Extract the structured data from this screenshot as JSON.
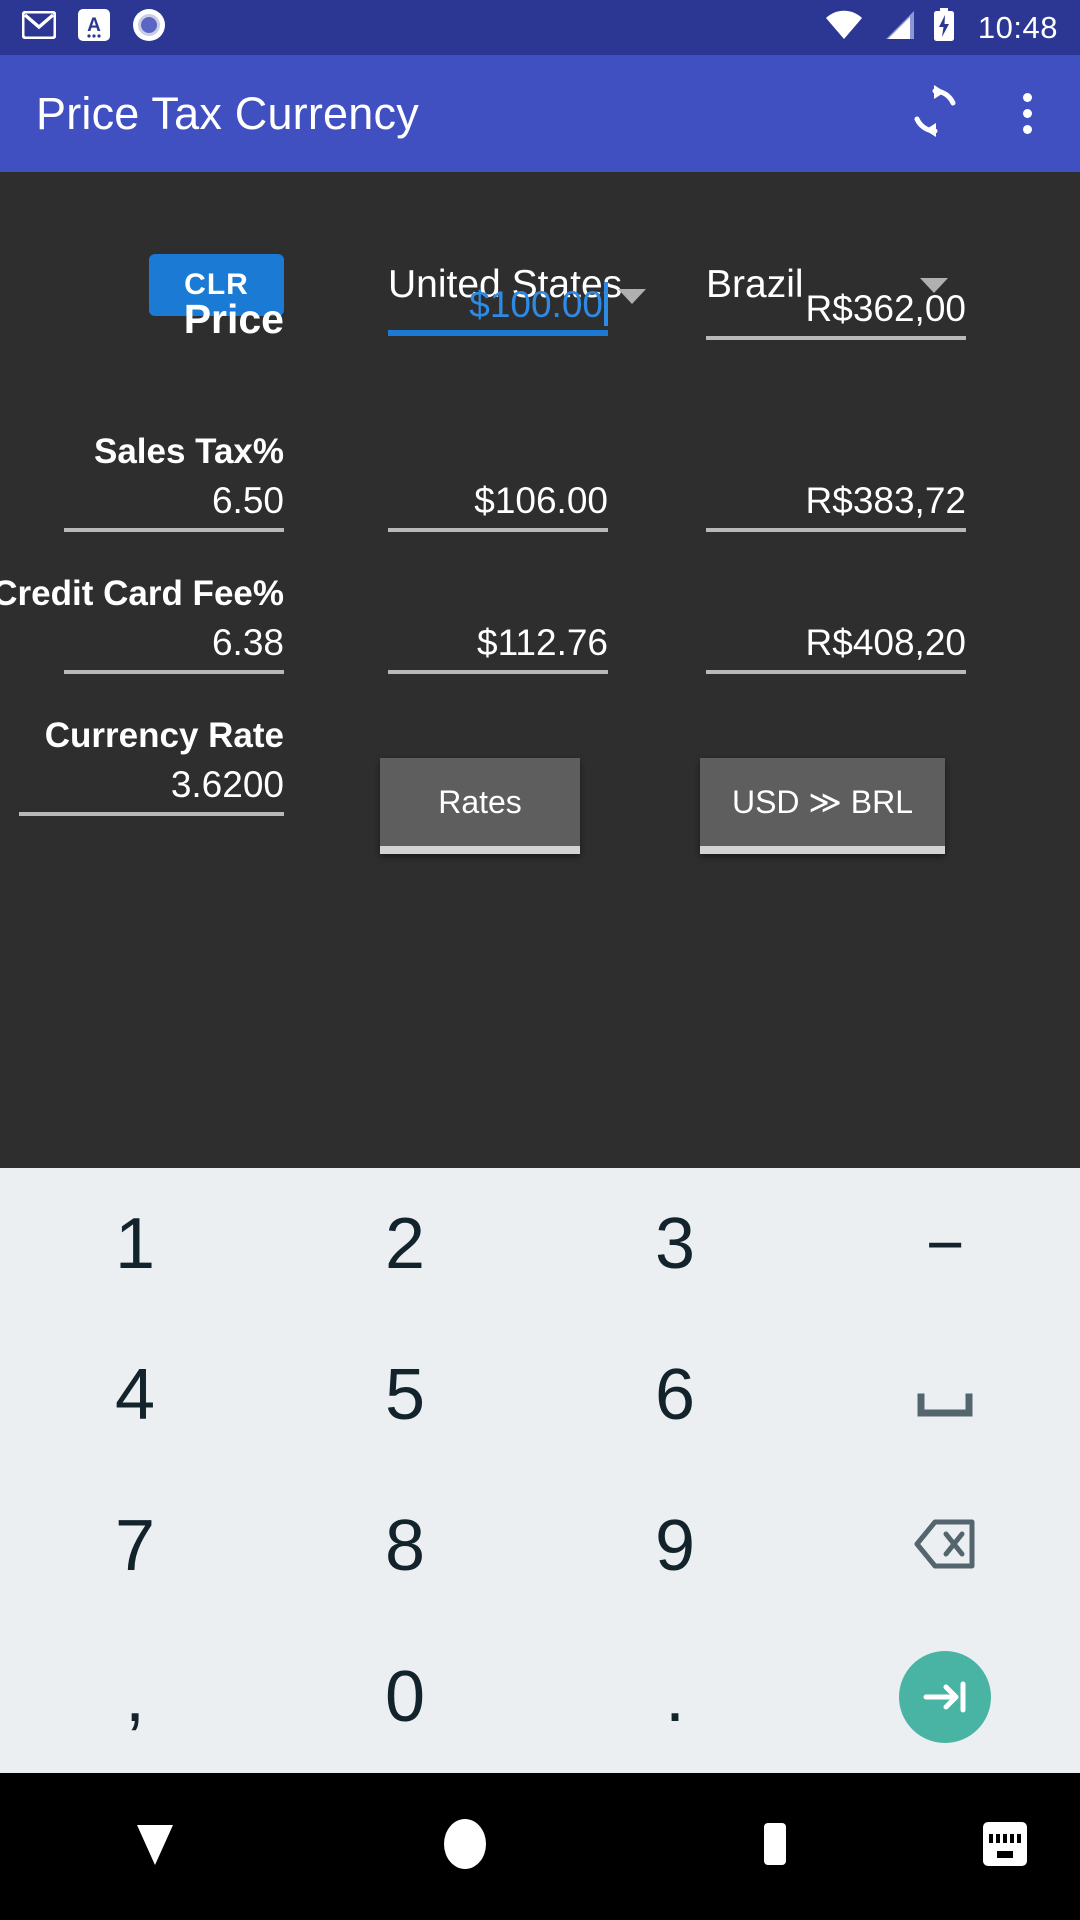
{
  "statusbar": {
    "icons": [
      "gmail-icon",
      "app-a-icon",
      "record-circle-icon"
    ],
    "wifi": "wifi-icon",
    "signal": "cell-signal-icon",
    "battery": "battery-charging-icon",
    "time": "10:48"
  },
  "appbar": {
    "title": "Price Tax Currency",
    "refresh": "refresh-icon",
    "overflow": "overflow-menu-icon"
  },
  "header": {
    "clear_label": "CLR",
    "country_a": "United States",
    "country_b": "Brazil"
  },
  "rows": {
    "price": {
      "caption": "Price",
      "value_a": "$100.00",
      "value_b": "R$362,00"
    },
    "sales_tax": {
      "caption": "Sales Tax%",
      "rate": "6.50",
      "value_a": "$106.00",
      "value_b": "R$383,72"
    },
    "credit_card_fee": {
      "caption": "Credit Card Fee%",
      "rate": "6.38",
      "value_a": "$112.76",
      "value_b": "R$408,20"
    },
    "currency_rate": {
      "caption": "Currency Rate",
      "rate": "3.6200",
      "rates_button": "Rates",
      "convert_button": "USD ≫ BRL"
    }
  },
  "colors": {
    "statusbar": "#2c3793",
    "appbar": "#4150c0",
    "panel": "#2e2e2e",
    "accent_blue": "#1a7ad4",
    "focus_blue": "#2d8ae5",
    "keyboard_bg": "#eceff1",
    "key_text": "#12232b",
    "enter_teal": "#49b3a4",
    "button_grey": "#5e5e5e"
  },
  "keyboard": {
    "rows": [
      [
        "1",
        "2",
        "3",
        "−"
      ],
      [
        "4",
        "5",
        "6",
        "space-key-icon"
      ],
      [
        "7",
        "8",
        "9",
        "backspace-icon"
      ],
      [
        ",",
        "0",
        ".",
        "next-field-icon"
      ]
    ]
  },
  "navbar": {
    "back": "back-arrow-icon",
    "home": "home-circle-icon",
    "recents": "recents-square-icon",
    "keyboard_toggle": "keyboard-toggle-icon"
  }
}
